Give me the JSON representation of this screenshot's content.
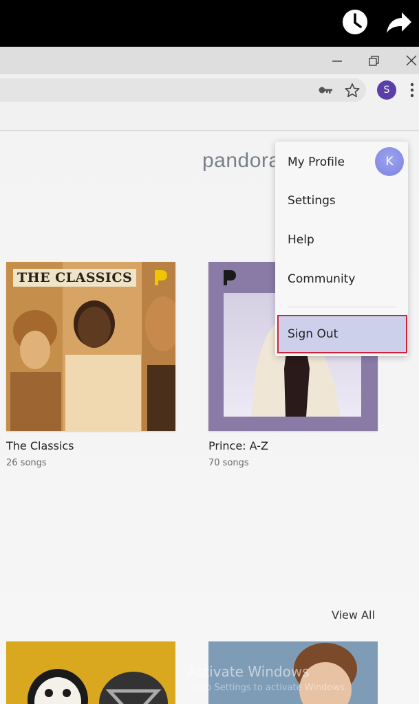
{
  "browser": {
    "profile_initial": "S"
  },
  "page": {
    "logo": "pandora",
    "playlists": [
      {
        "title": "The Classics",
        "songs": "26 songs",
        "banner": "THE CLASSICS"
      },
      {
        "title": "Prince: A-Z",
        "songs": "70 songs"
      }
    ],
    "view_all": "View All"
  },
  "account_menu": {
    "avatar_initial": "K",
    "items": [
      "My Profile",
      "Settings",
      "Help",
      "Community"
    ],
    "sign_out": "Sign Out"
  },
  "overlay": {
    "watermark_title": "Activate Windows",
    "watermark_sub": "Go to Settings to activate Windows."
  },
  "colors": {
    "highlight_border": "#d0213a",
    "signout_bg": "#ccd0ea",
    "avatar_bg": "#7b82e0"
  },
  "icons": [
    "clock-icon",
    "share-icon",
    "minimize-icon",
    "restore-icon",
    "close-icon",
    "key-icon",
    "star-icon",
    "menu-dots-icon",
    "pandora-p-icon"
  ]
}
